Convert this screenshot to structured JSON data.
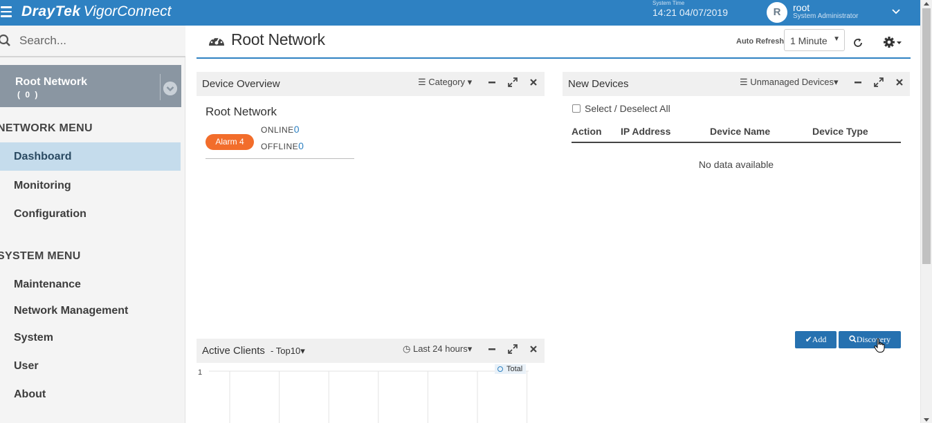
{
  "app": {
    "brand": "DrayTek",
    "product": "VigorConnect",
    "system_time_caption": "System Time",
    "system_time": "14:21 04/07/2019",
    "user": {
      "initial": "R",
      "name": "root",
      "role": "System Administrator"
    }
  },
  "sidebar": {
    "search_placeholder": "Search...",
    "root_network": {
      "title": "Root Network",
      "count": "( 0 )"
    },
    "network_menu_heading": "NETWORK MENU",
    "network_items": [
      {
        "label": "Dashboard",
        "active": true
      },
      {
        "label": "Monitoring"
      },
      {
        "label": "Configuration"
      }
    ],
    "system_menu_heading": "SYSTEM MENU",
    "system_items": [
      {
        "label": "Maintenance"
      },
      {
        "label": "Network Management"
      },
      {
        "label": "System"
      },
      {
        "label": "User"
      },
      {
        "label": "About"
      }
    ]
  },
  "main": {
    "title": "Root Network",
    "auto_refresh_label": "Auto Refresh:",
    "auto_refresh_value": "1 Minute"
  },
  "device_overview": {
    "title": "Device Overview",
    "dropdown": "Category",
    "network_name": "Root Network",
    "alarm_label": "Alarm 4",
    "online_label": "ONLINE",
    "online_count": "0",
    "offline_label": "OFFLINE",
    "offline_count": "0"
  },
  "new_devices": {
    "title": "New Devices",
    "dropdown": "Unmanaged Devices",
    "select_all_label": "Select / Deselect All",
    "columns": [
      "Action",
      "IP Address",
      "Device Name",
      "Device Type"
    ],
    "empty_text": "No data available",
    "add_button": "Add",
    "discovery_button": "Discovery"
  },
  "active_clients": {
    "title": "Active Clients",
    "top_dropdown": "- Top10",
    "time_dropdown": "Last 24 hours"
  },
  "chart_data": {
    "type": "line",
    "title": "",
    "xlabel": "",
    "ylabel": "",
    "y_tick_labels": [
      "1"
    ],
    "series": [
      {
        "name": "Total",
        "values": []
      }
    ],
    "legend_position": "top-right",
    "grid": true,
    "color": "#2e81c2"
  }
}
